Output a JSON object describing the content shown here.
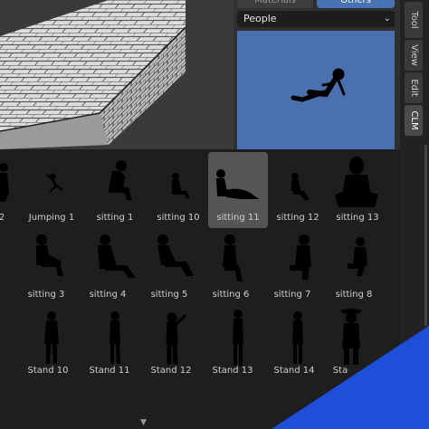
{
  "side_panel": {
    "tabs": [
      {
        "label": "Materials",
        "active": false
      },
      {
        "label": "Others",
        "active": true
      }
    ],
    "category": "People",
    "chevron_icon": "chevron-down-icon"
  },
  "vertical_tabs": [
    "Tool",
    "View",
    "Edit",
    "CLM"
  ],
  "assets": [
    {
      "label": "2"
    },
    {
      "label": "Jumping 1"
    },
    {
      "label": "sitting 1"
    },
    {
      "label": "sitting 10"
    },
    {
      "label": "sitting 11",
      "selected": true
    },
    {
      "label": "sitting 12"
    },
    {
      "label": "sitting 13"
    },
    {
      "label": "sitting 3"
    },
    {
      "label": "sitting 4"
    },
    {
      "label": "sitting 5"
    },
    {
      "label": "sitting 6"
    },
    {
      "label": "sitting 7"
    },
    {
      "label": "sitting 8"
    },
    {
      "label": "Stand 10"
    },
    {
      "label": "Stand 11"
    },
    {
      "label": "Stand 12"
    },
    {
      "label": "Stand 13"
    },
    {
      "label": "Stand 14"
    },
    {
      "label": "Sta"
    }
  ],
  "colors": {
    "accent": "#4772b3",
    "preview_bg": "#4a70b0",
    "corner_blue": "#1e4fd8"
  }
}
